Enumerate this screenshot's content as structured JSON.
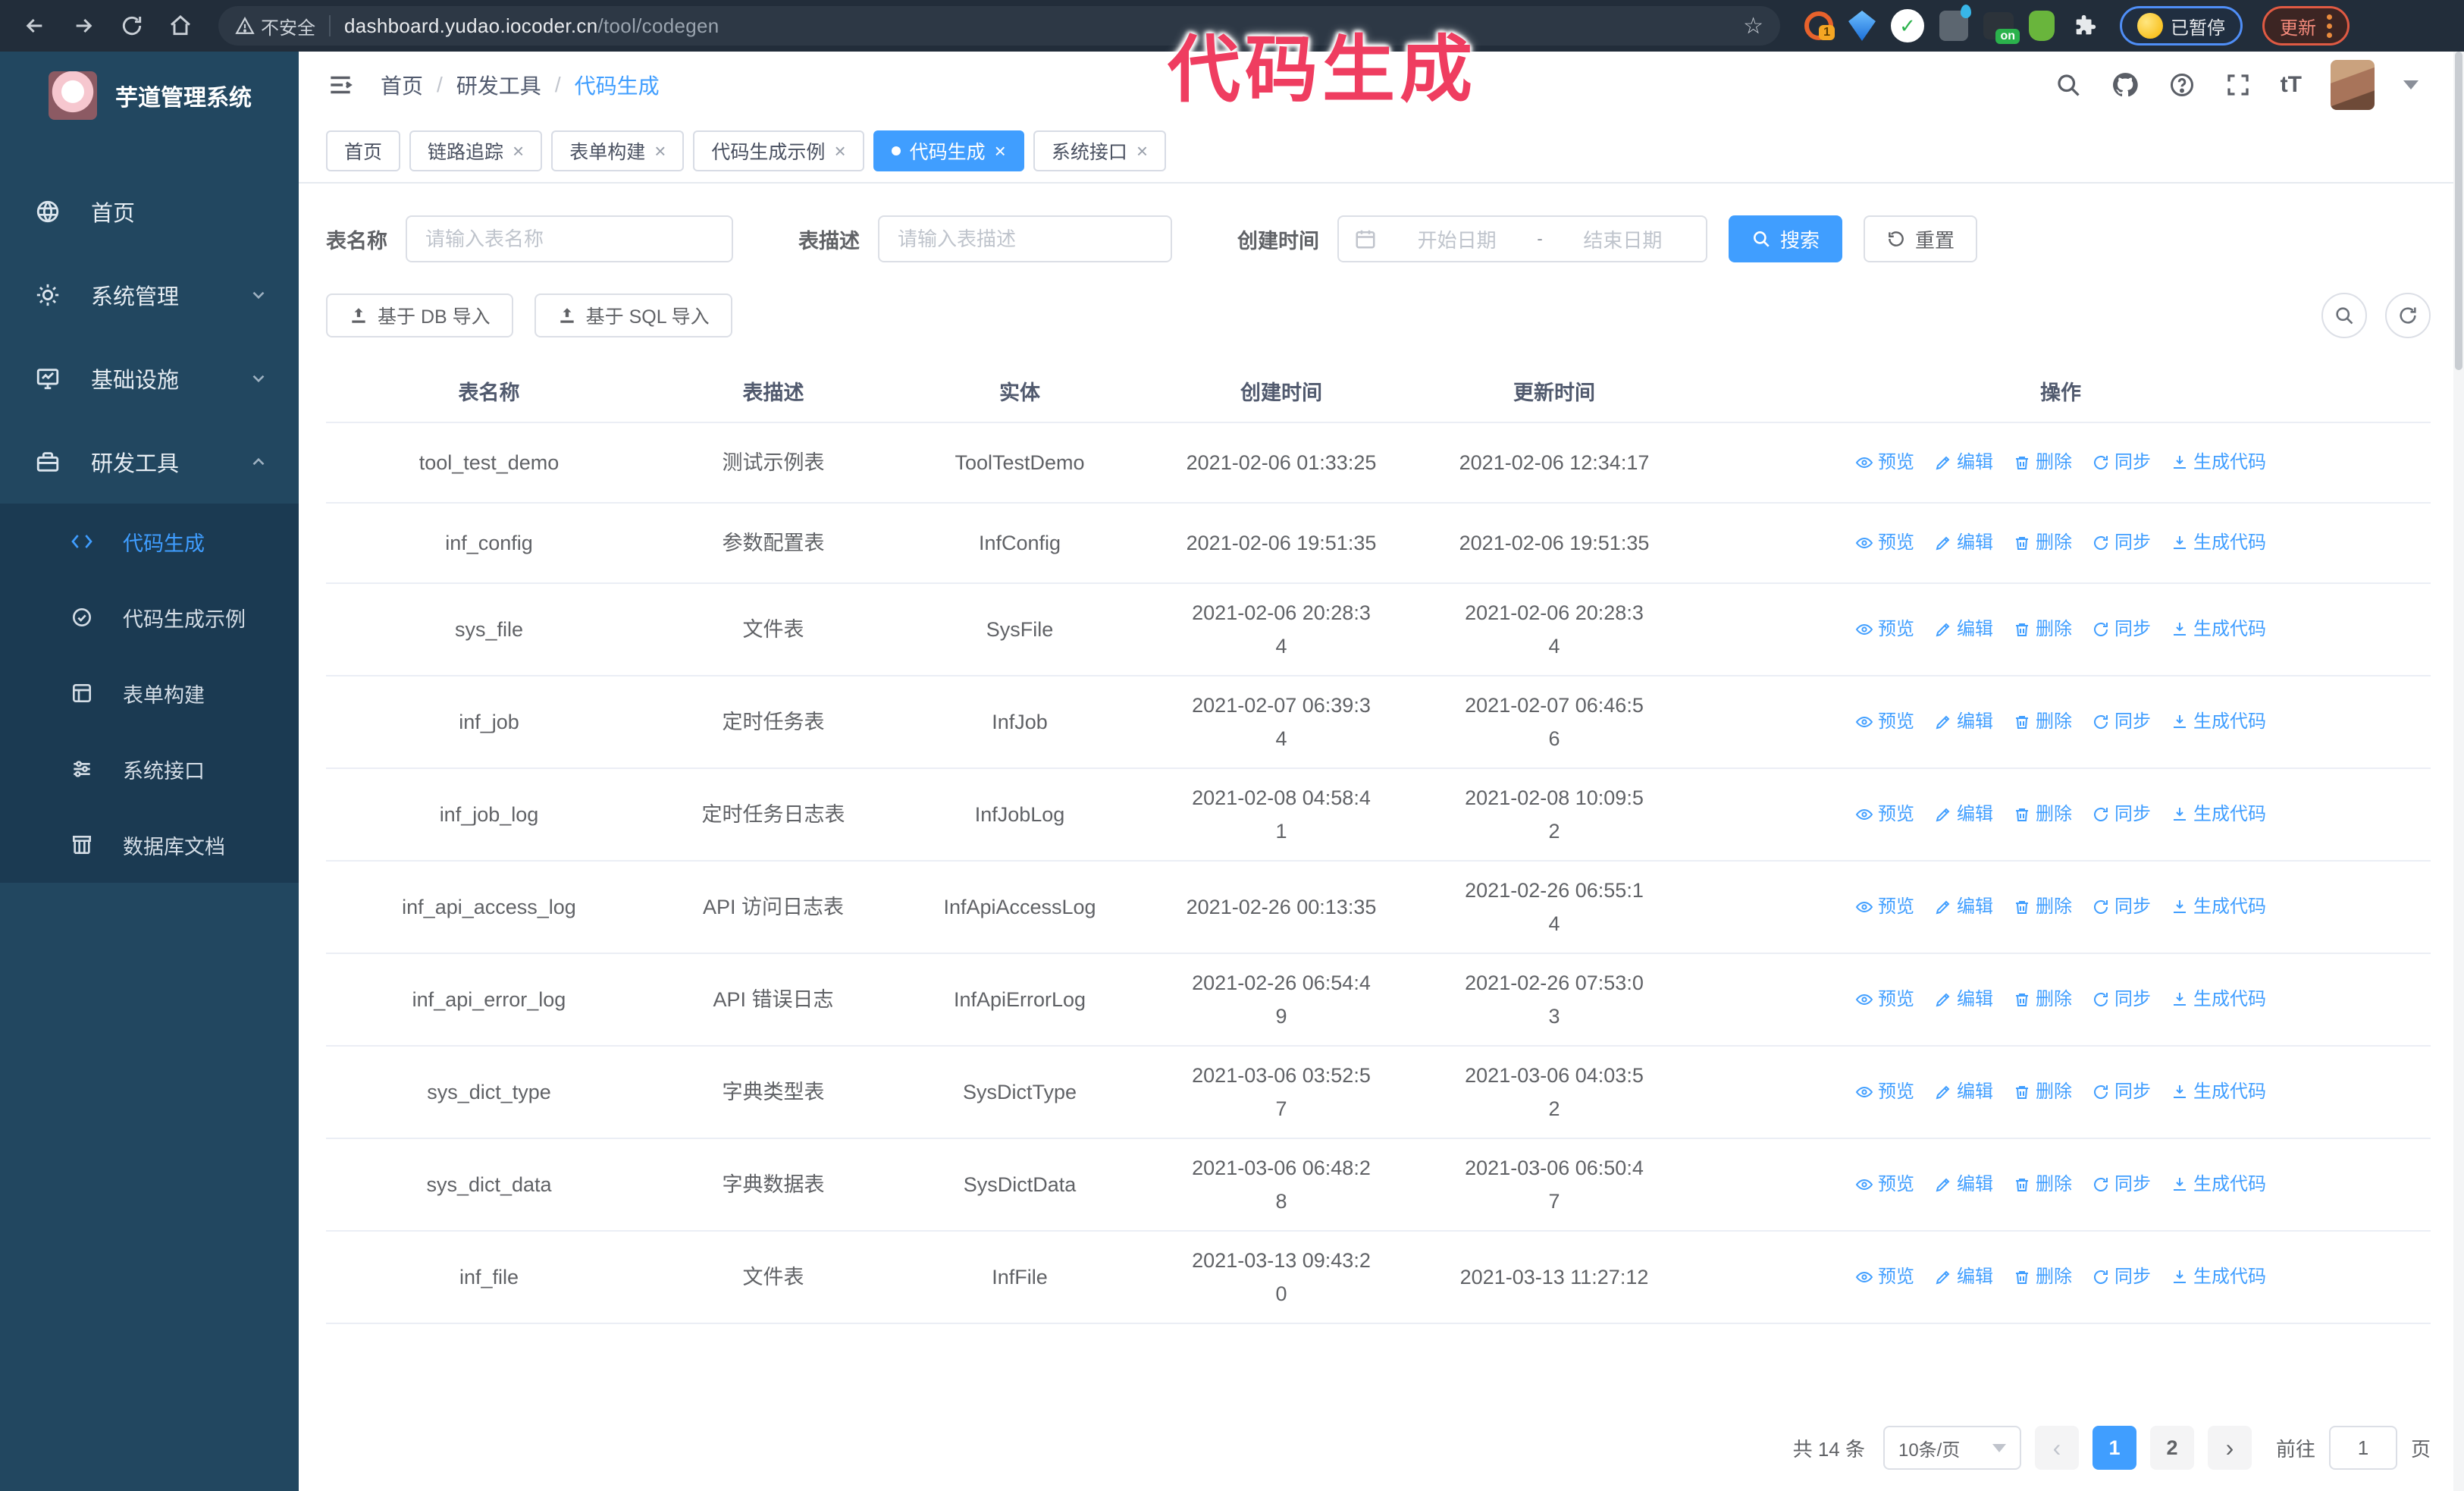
{
  "annotation": {
    "text": "代码生成"
  },
  "browser": {
    "security_label": "不安全",
    "url_host": "dashboard.yudao.iocoder.cn",
    "url_path": "/tool/codegen",
    "paused_chip": "已暂停",
    "update_button": "更新",
    "ext_badge_1": "1",
    "ext_badge_on": "on"
  },
  "sidebar": {
    "app_title": "芋道管理系统",
    "menu": [
      {
        "label": "首页"
      },
      {
        "label": "系统管理"
      },
      {
        "label": "基础设施"
      },
      {
        "label": "研发工具"
      }
    ],
    "submenu": [
      {
        "label": "代码生成"
      },
      {
        "label": "代码生成示例"
      },
      {
        "label": "表单构建"
      },
      {
        "label": "系统接口"
      },
      {
        "label": "数据库文档"
      }
    ]
  },
  "breadcrumb": [
    "首页",
    "研发工具",
    "代码生成"
  ],
  "tabs": [
    {
      "label": "首页"
    },
    {
      "label": "链路追踪"
    },
    {
      "label": "表单构建"
    },
    {
      "label": "代码生成示例"
    },
    {
      "label": "代码生成"
    },
    {
      "label": "系统接口"
    }
  ],
  "filters": {
    "table_name_label": "表名称",
    "table_name_placeholder": "请输入表名称",
    "table_desc_label": "表描述",
    "table_desc_placeholder": "请输入表描述",
    "create_time_label": "创建时间",
    "date_start_placeholder": "开始日期",
    "date_separator": "-",
    "date_end_placeholder": "结束日期",
    "search_label": "搜索",
    "reset_label": "重置"
  },
  "toolbar": {
    "import_db_label": "基于 DB 导入",
    "import_sql_label": "基于 SQL 导入"
  },
  "table": {
    "columns": [
      "表名称",
      "表描述",
      "实体",
      "创建时间",
      "更新时间",
      "操作"
    ],
    "actions": [
      "预览",
      "编辑",
      "删除",
      "同步",
      "生成代码"
    ],
    "rows": [
      {
        "name": "tool_test_demo",
        "desc": "测试示例表",
        "entity": "ToolTestDemo",
        "created": "2021-02-06 01:33:25",
        "updated": "2021-02-06 12:34:17"
      },
      {
        "name": "inf_config",
        "desc": "参数配置表",
        "entity": "InfConfig",
        "created": "2021-02-06 19:51:35",
        "updated": "2021-02-06 19:51:35"
      },
      {
        "name": "sys_file",
        "desc": "文件表",
        "entity": "SysFile",
        "created": "2021-02-06 20:28:3\n4",
        "updated": "2021-02-06 20:28:3\n4"
      },
      {
        "name": "inf_job",
        "desc": "定时任务表",
        "entity": "InfJob",
        "created": "2021-02-07 06:39:3\n4",
        "updated": "2021-02-07 06:46:5\n6"
      },
      {
        "name": "inf_job_log",
        "desc": "定时任务日志表",
        "entity": "InfJobLog",
        "created": "2021-02-08 04:58:4\n1",
        "updated": "2021-02-08 10:09:5\n2"
      },
      {
        "name": "inf_api_access_log",
        "desc": "API 访问日志表",
        "entity": "InfApiAccessLog",
        "created": "2021-02-26 00:13:35",
        "updated": "2021-02-26 06:55:1\n4"
      },
      {
        "name": "inf_api_error_log",
        "desc": "API 错误日志",
        "entity": "InfApiErrorLog",
        "created": "2021-02-26 06:54:4\n9",
        "updated": "2021-02-26 07:53:0\n3"
      },
      {
        "name": "sys_dict_type",
        "desc": "字典类型表",
        "entity": "SysDictType",
        "created": "2021-03-06 03:52:5\n7",
        "updated": "2021-03-06 04:03:5\n2"
      },
      {
        "name": "sys_dict_data",
        "desc": "字典数据表",
        "entity": "SysDictData",
        "created": "2021-03-06 06:48:2\n8",
        "updated": "2021-03-06 06:50:4\n7"
      },
      {
        "name": "inf_file",
        "desc": "文件表",
        "entity": "InfFile",
        "created": "2021-03-13 09:43:2\n0",
        "updated": "2021-03-13 11:27:12"
      }
    ]
  },
  "pagination": {
    "total_label": "共 14 条",
    "page_size": "10条/页",
    "pages": [
      "1",
      "2"
    ],
    "goto_label": "前往",
    "goto_value": "1",
    "page_label": "页"
  },
  "colors": {
    "primary": "#409EFF",
    "annotation": "#EF3D60",
    "sidebar": "#224760"
  }
}
